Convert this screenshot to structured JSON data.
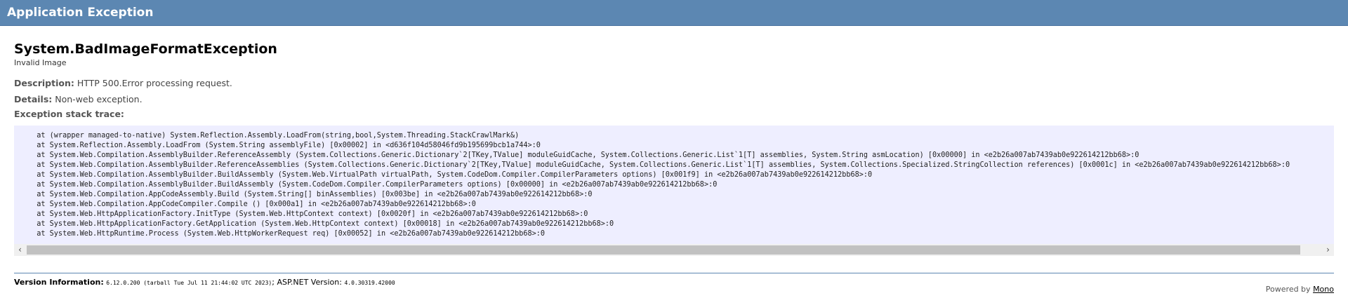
{
  "header": {
    "title": "Application Exception"
  },
  "exception": {
    "type": "System.BadImageFormatException",
    "message": "Invalid Image"
  },
  "description": {
    "label": "Description:",
    "text": "HTTP 500.Error processing request."
  },
  "details": {
    "label": "Details:",
    "text": "Non-web exception."
  },
  "stack_trace": {
    "label": "Exception stack trace:",
    "lines": [
      "  at (wrapper managed-to-native) System.Reflection.Assembly.LoadFrom(string,bool,System.Threading.StackCrawlMark&)",
      "  at System.Reflection.Assembly.LoadFrom (System.String assemblyFile) [0x00002] in <d636f104d58046fd9b195699bcb1a744>:0",
      "  at System.Web.Compilation.AssemblyBuilder.ReferenceAssembly (System.Collections.Generic.Dictionary`2[TKey,TValue] moduleGuidCache, System.Collections.Generic.List`1[T] assemblies, System.String asmLocation) [0x00000] in <e2b26a007ab7439ab0e922614212bb68>:0",
      "  at System.Web.Compilation.AssemblyBuilder.ReferenceAssemblies (System.Collections.Generic.Dictionary`2[TKey,TValue] moduleGuidCache, System.Collections.Generic.List`1[T] assemblies, System.Collections.Specialized.StringCollection references) [0x0001c] in <e2b26a007ab7439ab0e922614212bb68>:0",
      "  at System.Web.Compilation.AssemblyBuilder.BuildAssembly (System.Web.VirtualPath virtualPath, System.CodeDom.Compiler.CompilerParameters options) [0x001f9] in <e2b26a007ab7439ab0e922614212bb68>:0",
      "  at System.Web.Compilation.AssemblyBuilder.BuildAssembly (System.CodeDom.Compiler.CompilerParameters options) [0x00000] in <e2b26a007ab7439ab0e922614212bb68>:0",
      "  at System.Web.Compilation.AppCodeAssembly.Build (System.String[] binAssemblies) [0x003be] in <e2b26a007ab7439ab0e922614212bb68>:0",
      "  at System.Web.Compilation.AppCodeCompiler.Compile () [0x000a1] in <e2b26a007ab7439ab0e922614212bb68>:0",
      "  at System.Web.HttpApplicationFactory.InitType (System.Web.HttpContext context) [0x0020f] in <e2b26a007ab7439ab0e922614212bb68>:0",
      "  at System.Web.HttpApplicationFactory.GetApplication (System.Web.HttpContext context) [0x00018] in <e2b26a007ab7439ab0e922614212bb68>:0",
      "  at System.Web.HttpRuntime.Process (System.Web.HttpWorkerRequest req) [0x00052] in <e2b26a007ab7439ab0e922614212bb68>:0"
    ]
  },
  "version": {
    "label": "Version Information:",
    "mono_version": "6.12.0.200 (tarball Tue Jul 11 21:44:02 UTC 2023)",
    "separator": ";",
    "aspnet_label": "ASP.NET Version:",
    "aspnet_version": "4.0.30319.42000"
  },
  "footer": {
    "powered_by": "Powered by",
    "link": "Mono"
  },
  "scrollbar": {
    "left_arrow": "‹",
    "right_arrow": "›"
  }
}
